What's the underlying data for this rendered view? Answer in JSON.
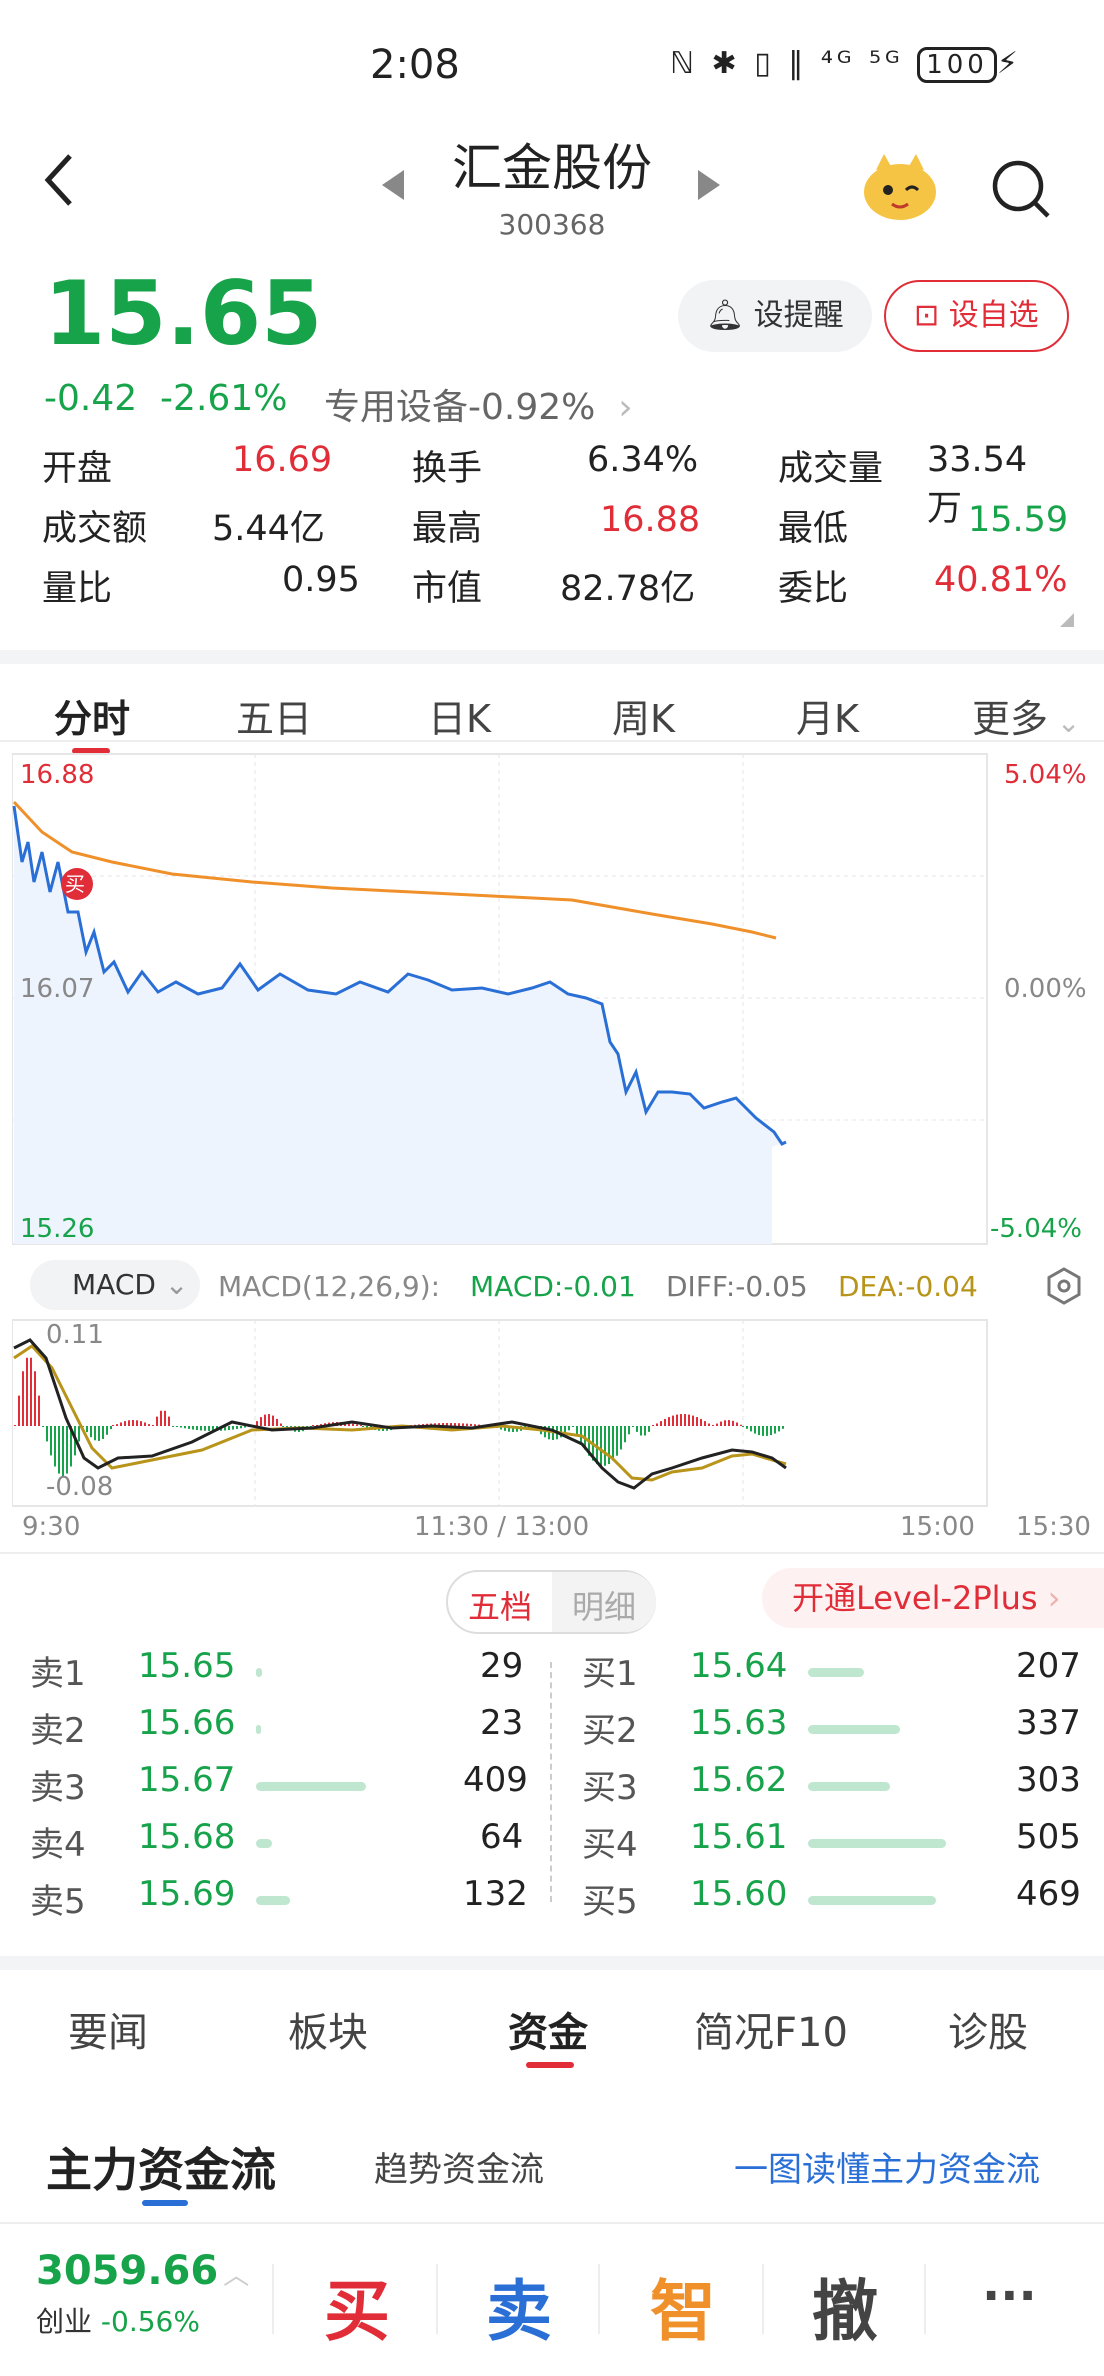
{
  "status_bar": {
    "time": "2:08",
    "icons_text": "ℕ ✱ ▯ ‖ ⁴ᴳ ⁵ᴳ",
    "battery": "100"
  },
  "header": {
    "title": "汇金股份",
    "code": "300368"
  },
  "quote": {
    "price": "15.65",
    "change": "-0.42",
    "change_pct": "-2.61%",
    "sector": "专用设备-0.92%",
    "alert_label": "设提醒",
    "watch_label": "设自选"
  },
  "stats": [
    [
      {
        "label": "开盘",
        "value": "16.69",
        "tone": "red"
      },
      {
        "label": "换手",
        "value": "6.34%",
        "tone": "neutral"
      },
      {
        "label": "成交量",
        "value": "33.54万",
        "tone": "neutral"
      }
    ],
    [
      {
        "label": "成交额",
        "value": "5.44亿",
        "tone": "neutral"
      },
      {
        "label": "最高",
        "value": "16.88",
        "tone": "red"
      },
      {
        "label": "最低",
        "value": "15.59",
        "tone": "green"
      }
    ],
    [
      {
        "label": "量比",
        "value": "0.95",
        "tone": "neutral"
      },
      {
        "label": "市值",
        "value": "82.78亿",
        "tone": "neutral"
      },
      {
        "label": "委比",
        "value": "40.81%",
        "tone": "red"
      }
    ]
  ],
  "chart_tabs": [
    "分时",
    "五日",
    "日K",
    "周K",
    "月K",
    "更多"
  ],
  "chart": {
    "y_top": "16.88",
    "y_mid": "16.07",
    "y_bottom": "15.26",
    "pct_top": "5.04%",
    "pct_mid": "0.00%",
    "pct_bottom": "-5.04%",
    "buy_marker": "买",
    "macd_select": "MACD",
    "macd_params": "MACD(12,26,9):",
    "macd_value": "MACD:-0.01",
    "diff_value": "DIFF:-0.05",
    "dea_value": "DEA:-0.04",
    "macd_top": "0.11",
    "macd_bottom": "-0.08",
    "x_labels": [
      "9:30",
      "11:30 / 13:00",
      "15:00",
      "15:30"
    ]
  },
  "order_book": {
    "tab_five": "五档",
    "tab_detail": "明细",
    "level2": "开通Level-2Plus",
    "sell": [
      {
        "label": "卖1",
        "price": "15.65",
        "qty": "29"
      },
      {
        "label": "卖2",
        "price": "15.66",
        "qty": "23"
      },
      {
        "label": "卖3",
        "price": "15.67",
        "qty": "409"
      },
      {
        "label": "卖4",
        "price": "15.68",
        "qty": "64"
      },
      {
        "label": "卖5",
        "price": "15.69",
        "qty": "132"
      }
    ],
    "buy": [
      {
        "label": "买1",
        "price": "15.64",
        "qty": "207"
      },
      {
        "label": "买2",
        "price": "15.63",
        "qty": "337"
      },
      {
        "label": "买3",
        "price": "15.62",
        "qty": "303"
      },
      {
        "label": "买4",
        "price": "15.61",
        "qty": "505"
      },
      {
        "label": "买5",
        "price": "15.60",
        "qty": "469"
      }
    ]
  },
  "info_tabs": [
    "要闻",
    "板块",
    "资金",
    "简况F10",
    "诊股"
  ],
  "fund_flow": {
    "main": "主力资金流",
    "trend": "趋势资金流",
    "link": "一图读懂主力资金流"
  },
  "bottom_bar": {
    "index_value": "3059.66",
    "index_name": "创业",
    "index_change": "-0.56%",
    "buy": "买",
    "sell": "卖",
    "smart": "智",
    "cancel": "撤",
    "more": "···"
  },
  "colors": {
    "up": "#e02d38",
    "down": "#16a34a",
    "accent": "#2a6fd6",
    "avg_line": "#f0902a"
  }
}
